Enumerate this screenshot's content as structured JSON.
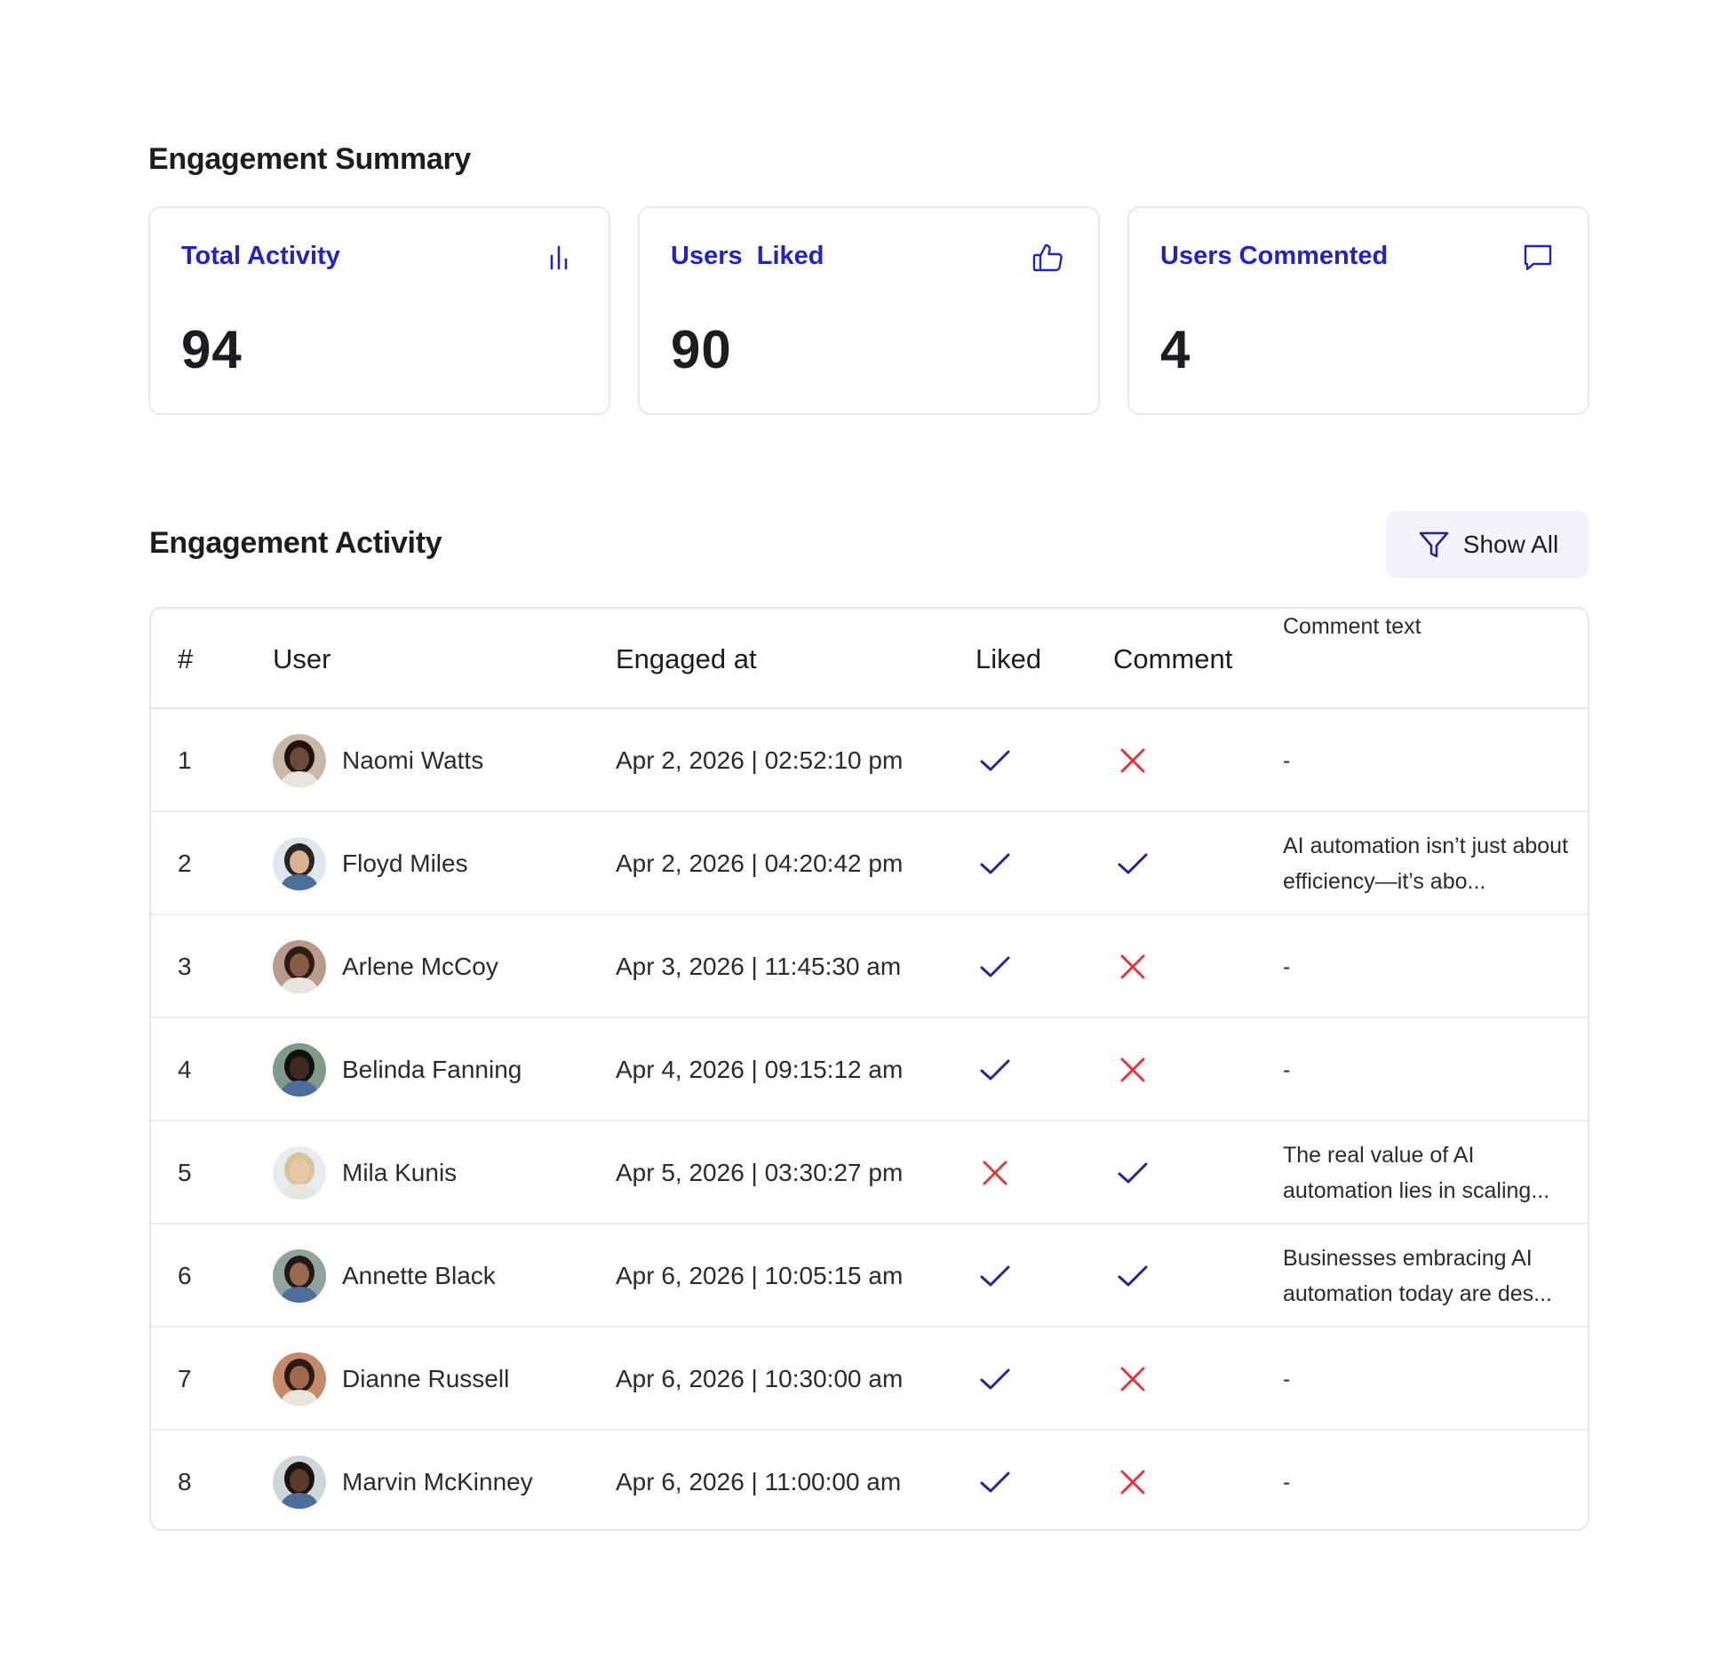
{
  "summary": {
    "title": "Engagement Summary",
    "cards": [
      {
        "label": "Total Activity",
        "value": "94",
        "icon": "bar-chart-icon"
      },
      {
        "label": "Users  Liked",
        "value": "90",
        "icon": "thumbs-up-icon"
      },
      {
        "label": "Users Commented",
        "value": "4",
        "icon": "comment-icon"
      }
    ]
  },
  "activity": {
    "title": "Engagement Activity",
    "filter_label": "Show All",
    "columns": [
      "#",
      "User",
      "Engaged at",
      "Liked",
      "Comment",
      "Comment text"
    ],
    "rows": [
      {
        "num": "1",
        "user": "Naomi Watts",
        "engaged_at": "Apr 2, 2026 | 02:52:10 pm",
        "liked": true,
        "comment": false,
        "comment_text": "-"
      },
      {
        "num": "2",
        "user": "Floyd Miles",
        "engaged_at": "Apr 2, 2026 | 04:20:42 pm",
        "liked": true,
        "comment": true,
        "comment_text": "AI automation isn’t just about efficiency—it’s abo..."
      },
      {
        "num": "3",
        "user": "Arlene McCoy",
        "engaged_at": "Apr 3, 2026 | 11:45:30 am",
        "liked": true,
        "comment": false,
        "comment_text": "-"
      },
      {
        "num": "4",
        "user": "Belinda Fanning",
        "engaged_at": "Apr 4, 2026 | 09:15:12 am",
        "liked": true,
        "comment": false,
        "comment_text": "-"
      },
      {
        "num": "5",
        "user": "Mila Kunis",
        "engaged_at": "Apr 5, 2026 | 03:30:27 pm",
        "liked": false,
        "comment": true,
        "comment_text": "The real value of AI automation lies in scaling..."
      },
      {
        "num": "6",
        "user": "Annette Black",
        "engaged_at": "Apr 6, 2026 | 10:05:15 am",
        "liked": true,
        "comment": true,
        "comment_text": "Businesses embracing AI automation today are des..."
      },
      {
        "num": "7",
        "user": "Dianne Russell",
        "engaged_at": "Apr 6, 2026 | 10:30:00 am",
        "liked": true,
        "comment": false,
        "comment_text": "-"
      },
      {
        "num": "8",
        "user": "Marvin McKinney",
        "engaged_at": "Apr 6, 2026 | 11:00:00 am",
        "liked": true,
        "comment": false,
        "comment_text": "-"
      }
    ]
  },
  "colors": {
    "accent": "#2323c2",
    "check": "#25258f",
    "cross": "#e0383d",
    "filter_bg": "#f4f3fd"
  }
}
